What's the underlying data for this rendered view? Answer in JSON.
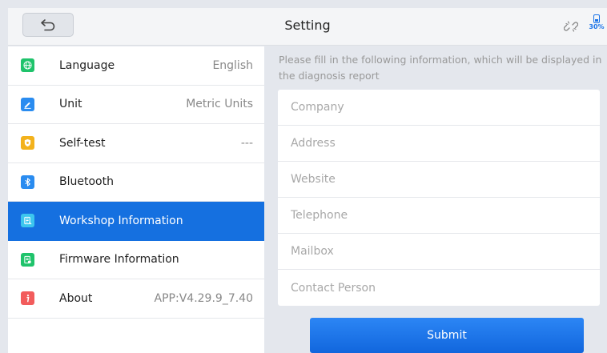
{
  "header": {
    "title": "Setting",
    "back_icon": "back-arrow-icon",
    "link_icon": "unlink-icon",
    "battery": {
      "icon": "battery-icon",
      "label": "30%",
      "color": "#1a73e8"
    }
  },
  "sidebar": {
    "items": [
      {
        "label": "Language",
        "value": "English",
        "icon": "globe-icon",
        "icon_color": "#1fc36b"
      },
      {
        "label": "Unit",
        "value": "Metric Units",
        "icon": "pencil-icon",
        "icon_color": "#2a8cf0"
      },
      {
        "label": "Self-test",
        "value": "---",
        "icon": "shield-icon",
        "icon_color": "#f3b21c"
      },
      {
        "label": "Bluetooth",
        "value": "",
        "icon": "bluetooth-icon",
        "icon_color": "#2a8cf0"
      },
      {
        "label": "Workshop Information",
        "value": "",
        "icon": "document-icon",
        "icon_color": "#3cc6ee",
        "active": true
      },
      {
        "label": "Firmware Information",
        "value": "",
        "icon": "firmware-icon",
        "icon_color": "#1fc36b"
      },
      {
        "label": "About",
        "value": "APP:V4.29.9_7.40",
        "icon": "info-icon",
        "icon_color": "#f25c5c"
      }
    ]
  },
  "content": {
    "hint": "Please fill in the following information, which will be displayed in the diagnosis report",
    "fields": [
      {
        "placeholder": "Company",
        "value": ""
      },
      {
        "placeholder": "Address",
        "value": ""
      },
      {
        "placeholder": "Website",
        "value": ""
      },
      {
        "placeholder": "Telephone",
        "value": ""
      },
      {
        "placeholder": "Mailbox",
        "value": ""
      },
      {
        "placeholder": "Contact Person",
        "value": ""
      }
    ],
    "submit_label": "Submit"
  },
  "colors": {
    "accent": "#1570e0",
    "background": "#e4e7ed"
  }
}
